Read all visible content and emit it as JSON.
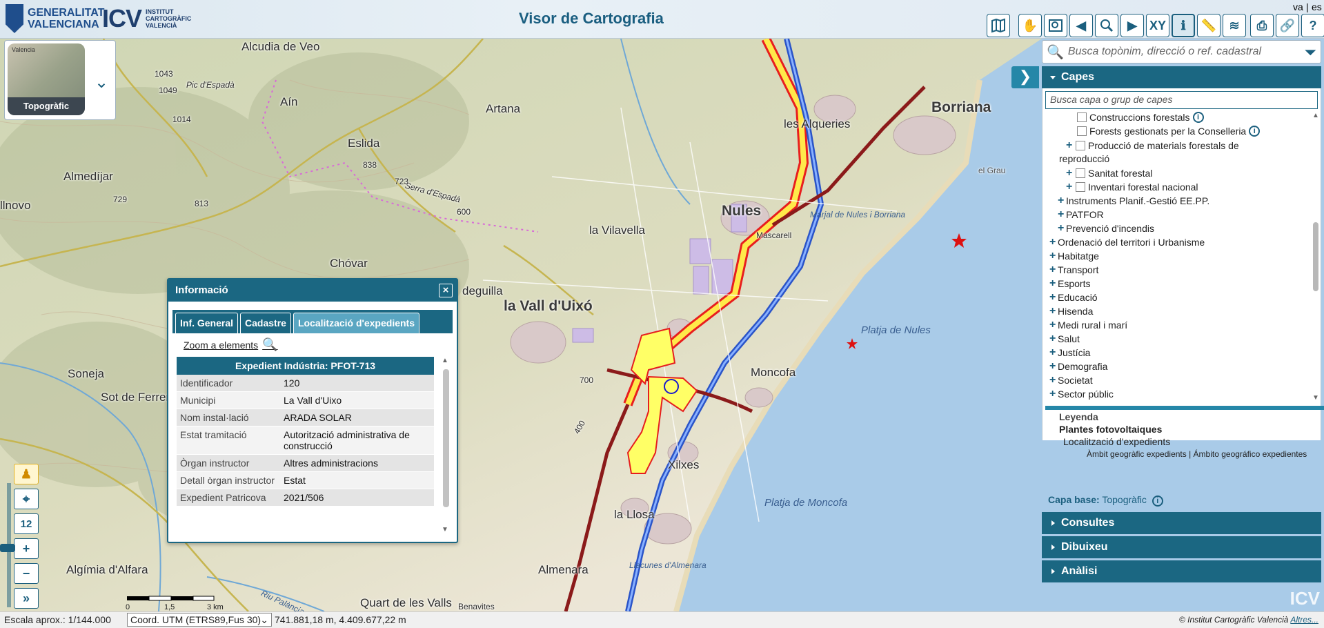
{
  "header": {
    "gva_line1": "GENERALITAT",
    "gva_line2": "VALENCIANA",
    "icv_text": "ICV",
    "icv_line1": "INSTITUT",
    "icv_line2": "CARTOGRÀFIC",
    "icv_line3": "VALENCIÀ",
    "title": "Visor de Cartografia",
    "lang_va": "va",
    "lang_sep": "|",
    "lang_es": "es",
    "xy_label": "XY"
  },
  "basemap": {
    "label": "Topogràfic",
    "thumb_label": "Valencia"
  },
  "map_labels": {
    "borriana": "Borriana",
    "les_alqueries": "les Alqueries",
    "nules": "Nules",
    "la_vilavella": "la Vilavella",
    "la_vall": "la Vall d'Uixó",
    "moncofa": "Moncofa",
    "xilxes": "Xilxes",
    "la_llosa": "la Llosa",
    "almenara": "Almenara",
    "artana": "Artana",
    "eslida": "Eslida",
    "ain": "Aín",
    "alcudia": "Alcudia de Veo",
    "almedijar": "Almedíjar",
    "chovar": "Chóvar",
    "soneja": "Soneja",
    "sot": "Sot de Ferrer",
    "algimia": "Algímia d'Alfara",
    "quart": "Quart de les Valls",
    "benavites": "Benavites",
    "illnovo": "llnovo",
    "deguilla": "deguilla",
    "pic": "Pic d'Espadà",
    "serra": "Serra d'Espadà",
    "platja_nules": "Platja de Nules",
    "platja_moncofa": "Platja de Moncofa",
    "marjal": "Marjal de Nules i Borriana",
    "el_grau": "el Grau",
    "llacunes": "Llacunes d'Almenara",
    "mascarell": "Mascarell",
    "riu_palancia": "Riu Palància",
    "h1043": "1043",
    "h1049": "1049",
    "h1014": "1014",
    "h729": "729",
    "h813": "813",
    "h723": "723",
    "h600": "600",
    "h838": "838",
    "h400": "400",
    "h700": "700"
  },
  "info_panel": {
    "title": "Informació",
    "close": "×",
    "tabs": [
      "Inf. General",
      "Cadastre",
      "Localització d'expedients"
    ],
    "zoom_label": "Zoom a elements",
    "expedient_title": "Expedient Indústria: PFOT-713",
    "rows": [
      {
        "k": "Identificador",
        "v": "120"
      },
      {
        "k": "Municipi",
        "v": "La Vall d'Uixo"
      },
      {
        "k": "Nom instal·lació",
        "v": "ARADA SOLAR"
      },
      {
        "k": "Estat tramitació",
        "v": "Autorització administrativa de construcció"
      },
      {
        "k": "Òrgan instructor",
        "v": "Altres administracions"
      },
      {
        "k": "Detall òrgan instructor",
        "v": "Estat"
      },
      {
        "k": "Expedient Patricova",
        "v": "2021/506"
      }
    ]
  },
  "map_tools": {
    "zoom_level": "12",
    "plus": "+",
    "minus": "−"
  },
  "scale": {
    "t0": "0",
    "t1": "1,5",
    "t2": "3 km"
  },
  "side_panel": {
    "search_placeholder": "Busca topònim, direcció o ref. cadastral",
    "capes_title": "Capes",
    "capes_search_placeholder": "Busca capa o grup de capes",
    "tree": [
      "Construccions forestals",
      "Forests gestionats per la Conselleria",
      "Producció de materials forestals de",
      "reproducció",
      "Sanitat forestal",
      "Inventari forestal nacional",
      "Instruments Planif.-Gestió EE.PP.",
      "PATFOR",
      "Prevenció d'incendis",
      "Ordenació del territori i Urbanisme",
      "Habitatge",
      "Transport",
      "Esports",
      "Educació",
      "Hisenda",
      "Medi rural i marí",
      "Salut",
      "Justícia",
      "Demografia",
      "Societat",
      "Sector públic"
    ],
    "legend_title": "Leyenda",
    "legend_group": "Plantes fotovoltaiques",
    "legend_layer": "Localització d'expedients",
    "legend_item": "Àmbit geogràfic expedients | Ámbito geográfico expedientes",
    "capa_base_label": "Capa base:",
    "capa_base_value": "Topogràfic",
    "consultes": "Consultes",
    "dibuixeu": "Dibuixeu",
    "analisi": "Anàlisi"
  },
  "status": {
    "scale": "Escala aprox.: 1/144.000",
    "coord_system": "Coord. UTM (ETRS89,Fus 30)",
    "coords": "741.881,18 m, 4.409.677,22 m",
    "copyright": "© Institut Cartogràfic Valencià",
    "copyright_link": "Altres..."
  },
  "watermark": "ICV",
  "colors": {
    "primary": "#1b6782",
    "accent": "#2587a8",
    "sea": "#a9cbe8",
    "expedient_fill": "#ffff66",
    "expedient_stroke": "#e61e1e"
  }
}
